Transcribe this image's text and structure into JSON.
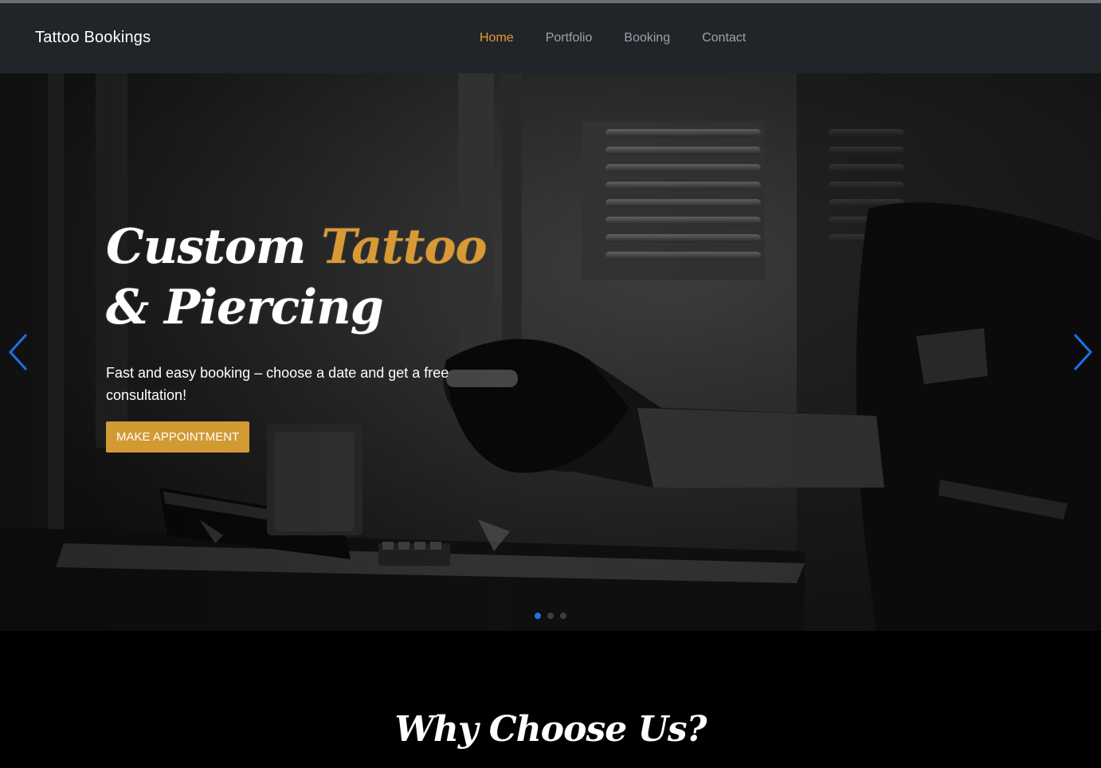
{
  "navbar": {
    "brand": "Tattoo Bookings",
    "links": [
      {
        "label": "Home",
        "active": true
      },
      {
        "label": "Portfolio",
        "active": false
      },
      {
        "label": "Booking",
        "active": false
      },
      {
        "label": "Contact",
        "active": false
      }
    ]
  },
  "hero": {
    "headline_part1": "Custom ",
    "headline_accent": "Tattoo",
    "headline_part2": " & Piercing",
    "subtext": "Fast and easy booking – choose a date and get a free consultation!",
    "button_label": "MAKE APPOINTMENT",
    "carousel": {
      "slide_count": 3,
      "active_slide": 1
    },
    "icons": {
      "prev": "chevron-left-icon",
      "next": "chevron-right-icon"
    }
  },
  "why_section": {
    "title": "Why Choose Us?"
  },
  "colors": {
    "accent": "#e29b2d",
    "button": "#d29a33",
    "navbar_bg": "#212429",
    "arrow": "#1a73e8"
  }
}
